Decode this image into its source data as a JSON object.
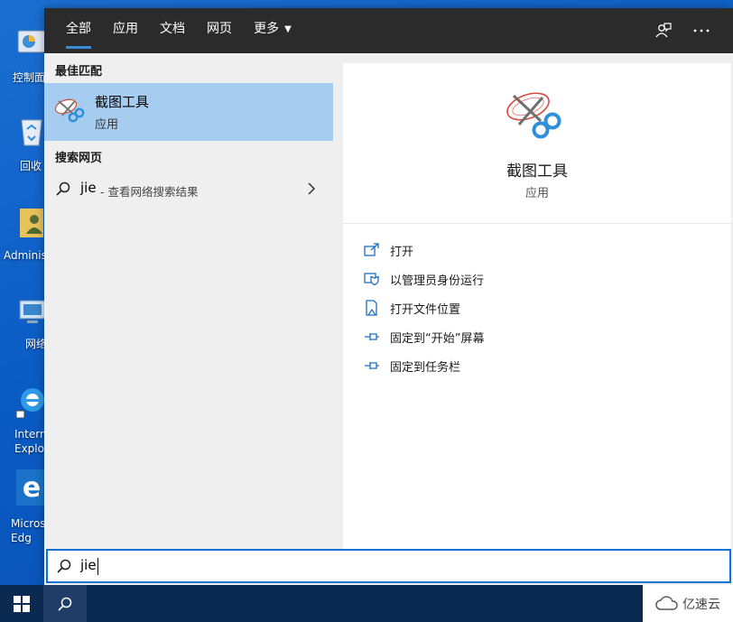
{
  "desktop": {
    "icons": [
      {
        "name": "control-panel-icon",
        "label": "控制面"
      },
      {
        "name": "recycle-bin-icon",
        "label": "回收"
      },
      {
        "name": "user-folder-icon",
        "label": "Adminis"
      },
      {
        "name": "network-icon",
        "label": "网络"
      },
      {
        "name": "internet-explorer-icon",
        "label": "Intern\nExplo"
      },
      {
        "name": "edge-icon",
        "label": "Micros\nEdg"
      }
    ]
  },
  "tabs": {
    "all": "全部",
    "apps": "应用",
    "documents": "文档",
    "web": "网页",
    "more": "更多"
  },
  "results": {
    "best_match_heading": "最佳匹配",
    "best_match": {
      "title": "截图工具",
      "subtitle": "应用"
    },
    "web_heading": "搜索网页",
    "web_query": "jie",
    "web_hint": "- 查看网络搜索结果"
  },
  "detail": {
    "app_name": "截图工具",
    "app_type": "应用",
    "actions": [
      {
        "icon": "open-icon",
        "label": "打开"
      },
      {
        "icon": "admin-shield-icon",
        "label": "以管理员身份运行"
      },
      {
        "icon": "file-location-icon",
        "label": "打开文件位置"
      },
      {
        "icon": "pin-icon",
        "label": "固定到“开始”屏幕"
      },
      {
        "icon": "pin-icon",
        "label": "固定到任务栏"
      }
    ]
  },
  "search": {
    "value": "jie"
  },
  "watermark": {
    "text": "亿速云"
  },
  "colors": {
    "tab_bar": "#2b2b2b",
    "selected_result": "#a6cdf0",
    "accent": "#0a74d4",
    "taskbar": "#0b2a52"
  }
}
